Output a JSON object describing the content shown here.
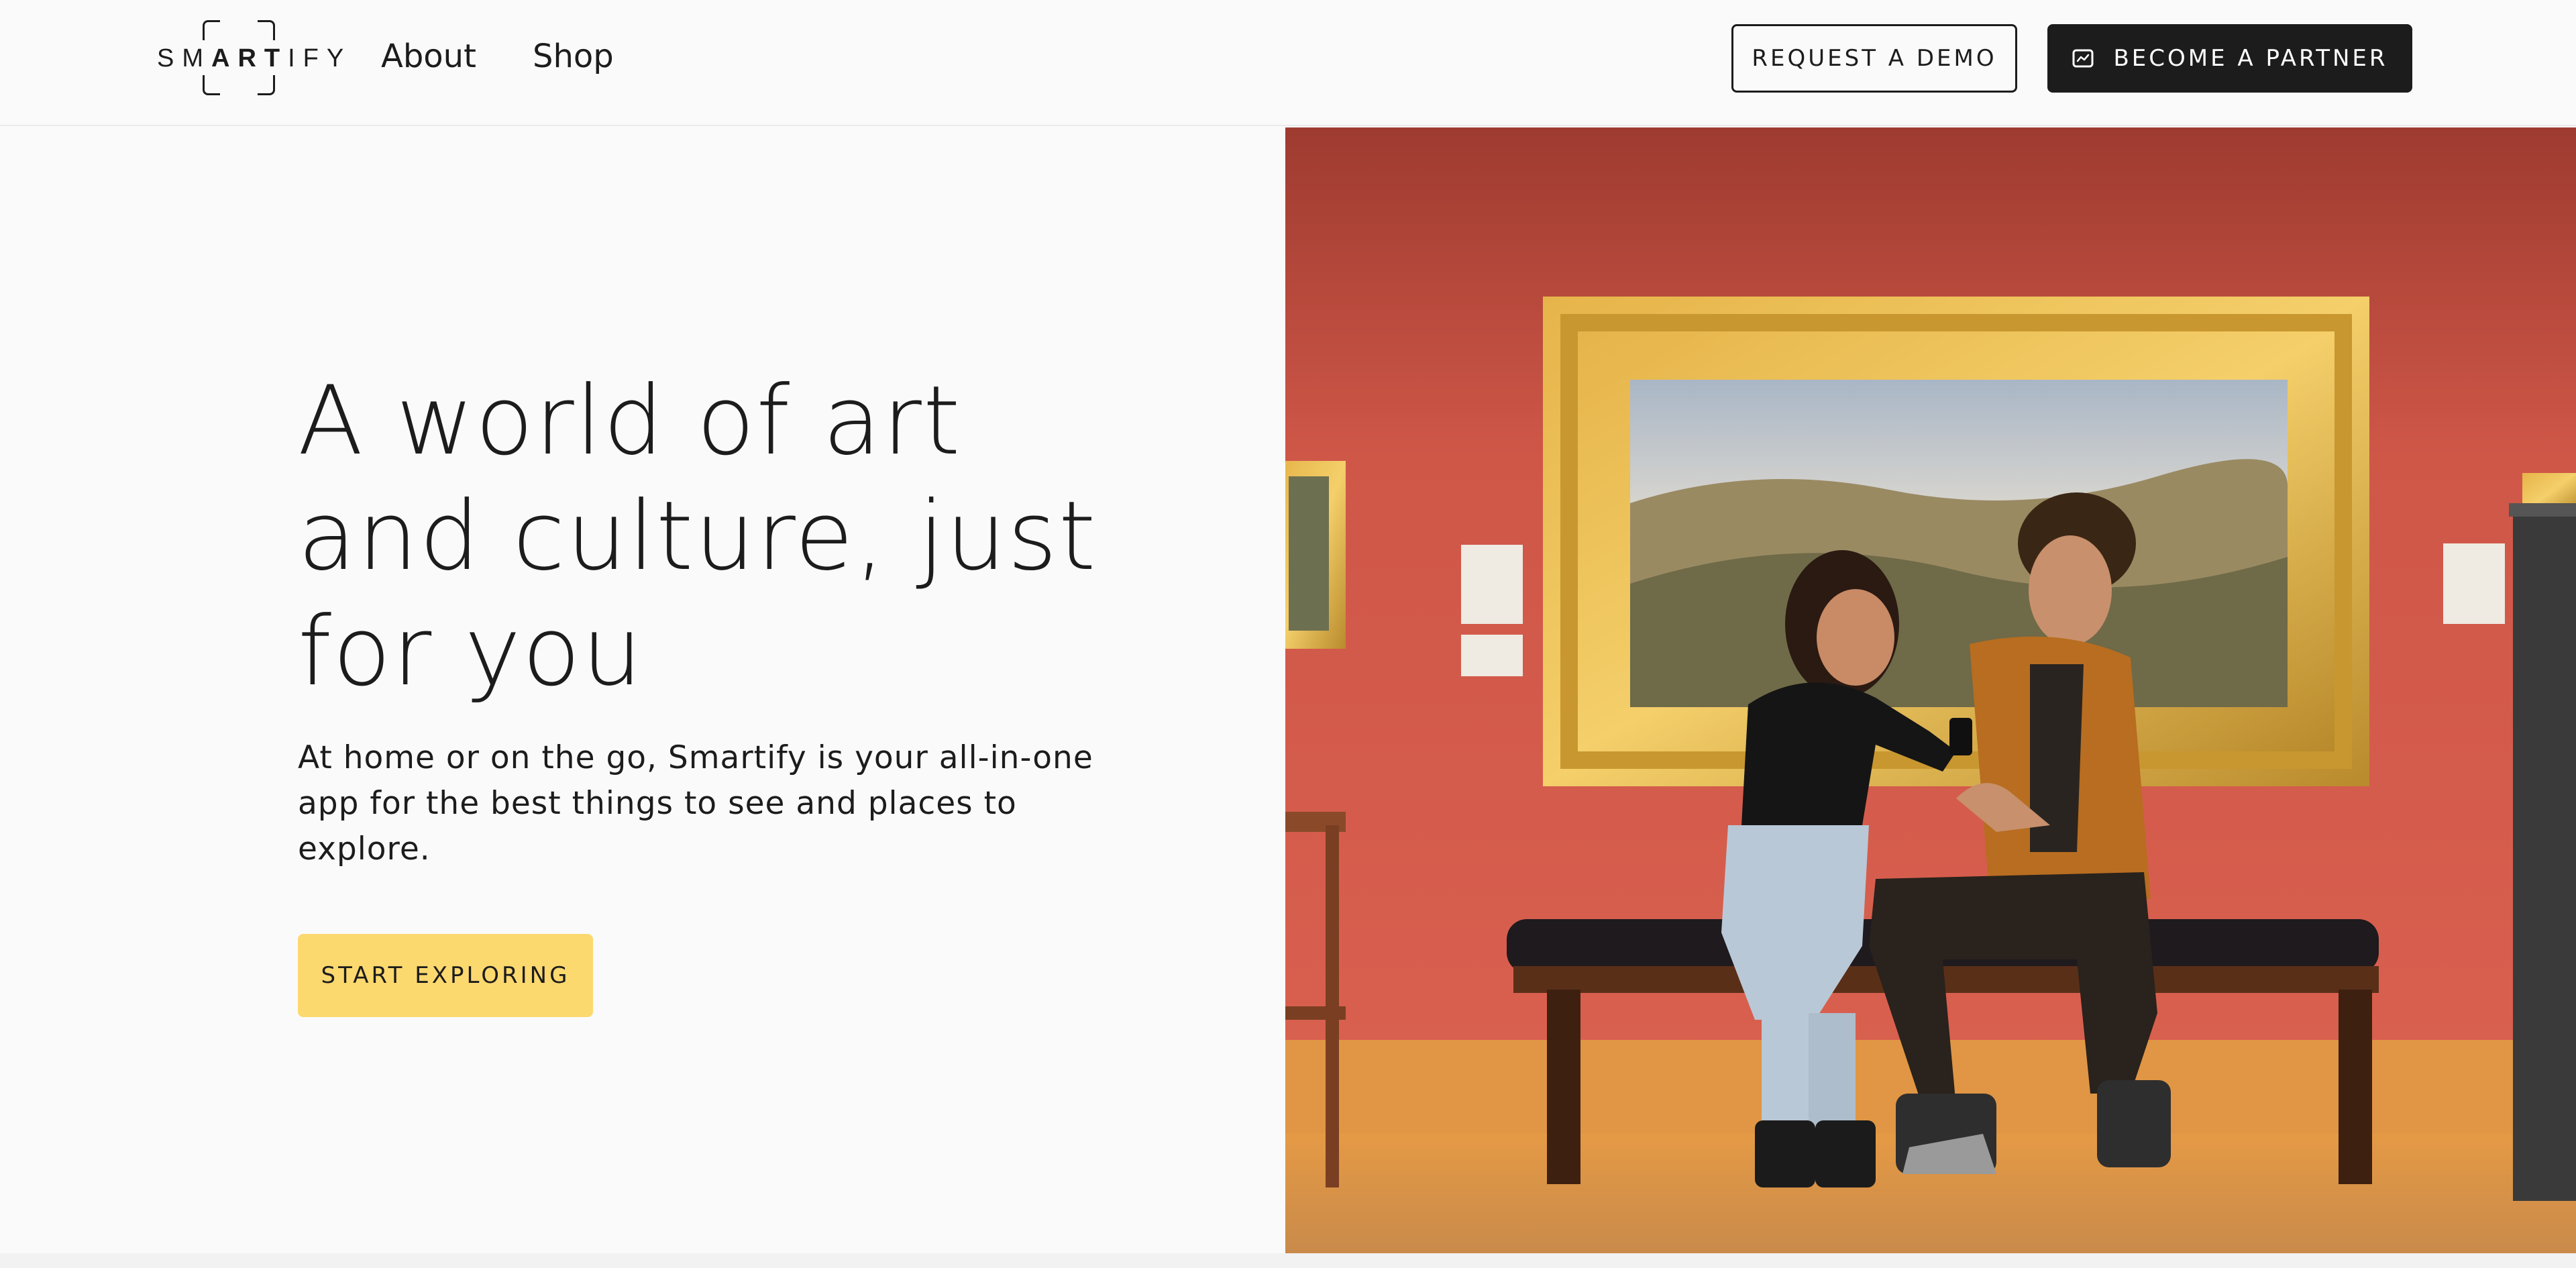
{
  "header": {
    "logo": {
      "text_light_1": "SM",
      "text_bold": "ART",
      "text_light_2": "IFY"
    },
    "nav": [
      {
        "label": "About"
      },
      {
        "label": "Shop"
      }
    ],
    "request_demo_label": "REQUEST A DEMO",
    "become_partner_label": "BECOME A PARTNER",
    "become_partner_icon": "gallery-frame-icon"
  },
  "hero": {
    "headline": "A world of art and culture, just for you",
    "subcopy": "At home or on the go, Smartify is your all-in-one app for the best things to see and places to explore.",
    "cta_label": "START EXPLORING",
    "cta_color": "#fcd96f"
  },
  "colors": {
    "background": "#fafafa",
    "text": "#1c1c1c",
    "gallery_wall": "#d25a4c"
  }
}
